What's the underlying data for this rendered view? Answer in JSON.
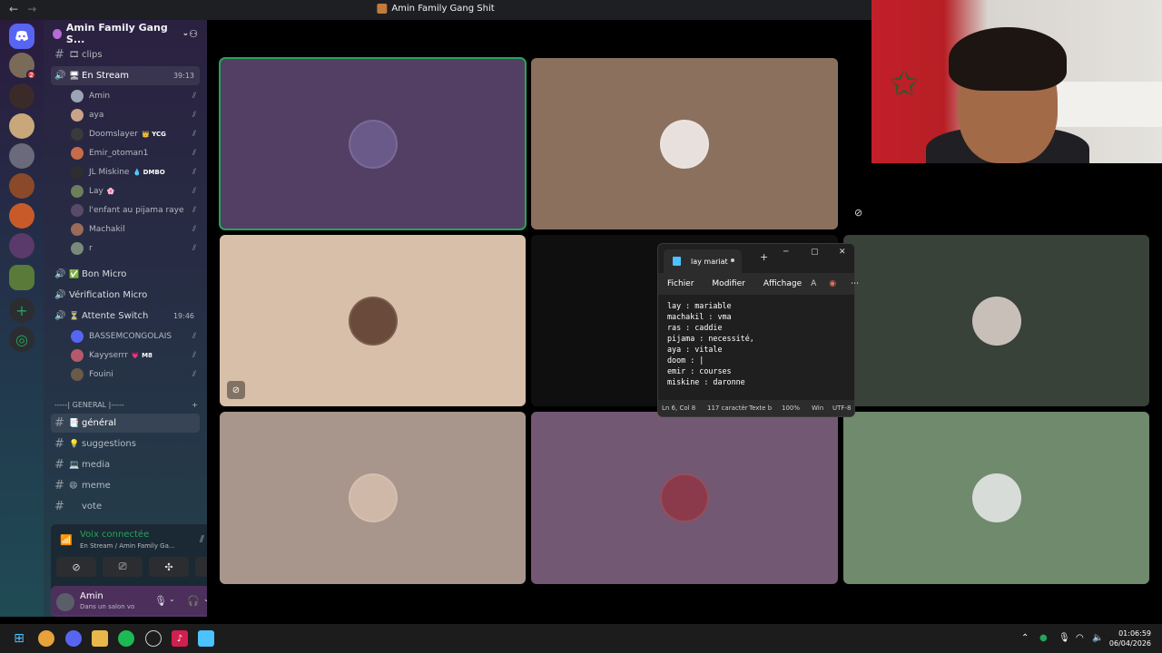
{
  "window": {
    "title": "Amin Family Gang Shit"
  },
  "server": {
    "name": "Amin Family Gang S..."
  },
  "channels_top": [
    {
      "label": "clips",
      "emoji": "🎞"
    },
    {
      "label": "En Stream",
      "emoji": "🖥",
      "time": "39:13"
    }
  ],
  "stream_users": [
    {
      "name": "Amin",
      "tag": "",
      "color": "#9aa4b5"
    },
    {
      "name": "aya",
      "tag": "",
      "color": "#c9a38a"
    },
    {
      "name": "Doomslayer",
      "tag": "👑 YCG",
      "color": "#3a3a3a"
    },
    {
      "name": "Emir_otoman1",
      "tag": "",
      "color": "#c86b4a"
    },
    {
      "name": "JL Miskine",
      "tag": "💧 DMBO",
      "color": "#2e2e2e"
    },
    {
      "name": "Lay",
      "tag": "🌸",
      "color": "#6d7f5a"
    },
    {
      "name": "l'enfant au pijama raye",
      "tag": "",
      "color": "#5a4a6a"
    },
    {
      "name": "Machakil",
      "tag": "",
      "color": "#9a6a5a"
    },
    {
      "name": "r",
      "tag": "",
      "color": "#7a8a7a"
    }
  ],
  "voice_channels": [
    {
      "label": "Bon Micro",
      "emoji": "✅"
    },
    {
      "label": "Vérification Micro",
      "emoji": ""
    },
    {
      "label": "Attente Switch",
      "emoji": "⏳",
      "time": "19:46"
    }
  ],
  "switch_users": [
    {
      "name": "BASSEMCONGOLAIS",
      "tag": "",
      "color": "#5865f2"
    },
    {
      "name": "Kayyserrr",
      "tag": "💗 M8",
      "color": "#b55a6a"
    },
    {
      "name": "Fouini",
      "tag": "",
      "color": "#6a5a4a"
    }
  ],
  "category": {
    "label": "-----| GENERAL |-----"
  },
  "text_channels": [
    {
      "label": "général",
      "emoji": "📑"
    },
    {
      "label": "suggestions",
      "emoji": "💡"
    },
    {
      "label": "media",
      "emoji": "💻"
    },
    {
      "label": "meme",
      "emoji": "😄"
    },
    {
      "label": "vote",
      "emoji": ""
    }
  ],
  "voice_status": {
    "title": "Voix connectée",
    "subtitle": "En Stream / Amin Family Ga..."
  },
  "current_user": {
    "name": "Amin",
    "status": "Dans un salon vo"
  },
  "notepad": {
    "tab_title": "lay mariat",
    "menu": [
      "Fichier",
      "Modifier",
      "Affichage"
    ],
    "lines": [
      "lay : mariable",
      "machakil : vma",
      "ras : caddie",
      "pijama : necessité,",
      "aya : vitale",
      "doom : |",
      "emir : courses",
      "miskine : daronne"
    ],
    "status": {
      "position": "Ln 6, Col 8",
      "chars": "117 caractèr",
      "type": "Texte b",
      "zoom": "100%",
      "eol": "Win",
      "encoding": "UTF-8"
    }
  },
  "clock": {
    "time": "01:06:59",
    "date": "06/04/2026"
  },
  "colors": {
    "tile_purple": "#533f63",
    "tile_brown": "#8a705d",
    "tile_peach": "#d8bfa9",
    "tile_darkgreen": "#384238",
    "tile_taupe": "#a8968c",
    "tile_mauve": "#735873",
    "tile_sage": "#6f8a6c",
    "accent_green": "#23a55a"
  }
}
